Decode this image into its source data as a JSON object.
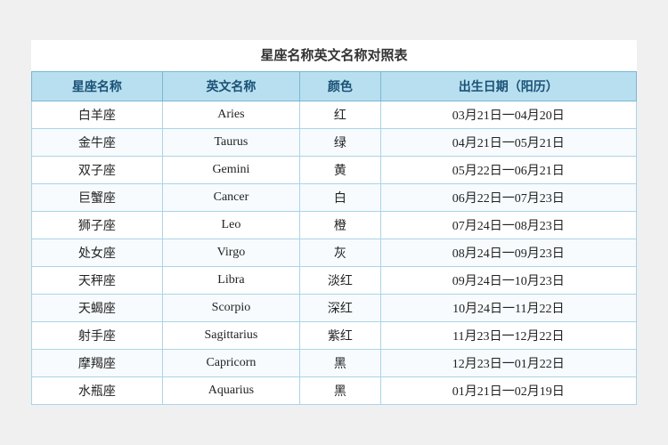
{
  "title": "星座名称英文名称对照表",
  "headers": [
    "星座名称",
    "英文名称",
    "颜色",
    "出生日期（阳历）"
  ],
  "rows": [
    {
      "chinese": "白羊座",
      "english": "Aries",
      "color": "红",
      "date": "03月21日一04月20日"
    },
    {
      "chinese": "金牛座",
      "english": "Taurus",
      "color": "绿",
      "date": "04月21日一05月21日"
    },
    {
      "chinese": "双子座",
      "english": "Gemini",
      "color": "黄",
      "date": "05月22日一06月21日"
    },
    {
      "chinese": "巨蟹座",
      "english": "Cancer",
      "color": "白",
      "date": "06月22日一07月23日"
    },
    {
      "chinese": "狮子座",
      "english": "Leo",
      "color": "橙",
      "date": "07月24日一08月23日"
    },
    {
      "chinese": "处女座",
      "english": "Virgo",
      "color": "灰",
      "date": "08月24日一09月23日"
    },
    {
      "chinese": "天秤座",
      "english": "Libra",
      "color": "淡红",
      "date": "09月24日一10月23日"
    },
    {
      "chinese": "天蝎座",
      "english": "Scorpio",
      "color": "深红",
      "date": "10月24日一11月22日"
    },
    {
      "chinese": "射手座",
      "english": "Sagittarius",
      "color": "紫红",
      "date": "11月23日一12月22日"
    },
    {
      "chinese": "摩羯座",
      "english": "Capricorn",
      "color": "黑",
      "date": "12月23日一01月22日"
    },
    {
      "chinese": "水瓶座",
      "english": "Aquarius",
      "color": "黑",
      "date": "01月21日一02月19日"
    }
  ]
}
